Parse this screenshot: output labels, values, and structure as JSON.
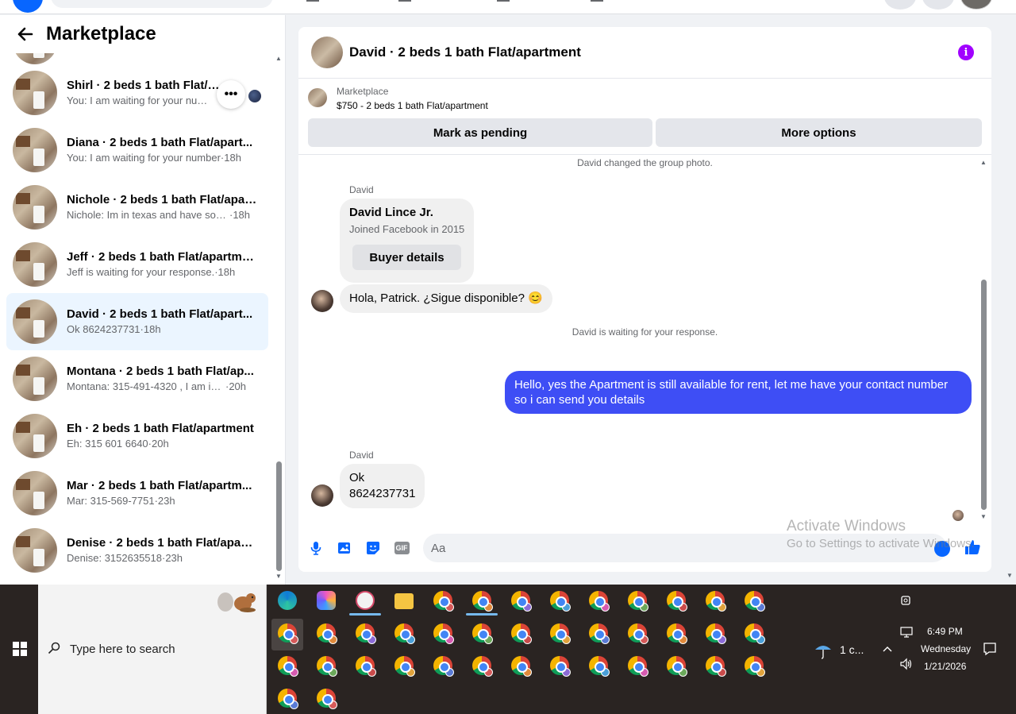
{
  "marketplace": {
    "title": "Marketplace",
    "conversations": [
      {
        "name": "Shirl · 2 beds 1 bath Flat/apartment",
        "preview": "You: I am waiting for your num...",
        "time": ""
      },
      {
        "name": "Diana · 2 beds 1 bath Flat/apart...",
        "preview": "You: I am waiting for your number",
        "time": "·18h"
      },
      {
        "name": "Nichole · 2 beds 1 bath Flat/apar...",
        "preview": "Nichole: Im in texas and have som...",
        "time": "·18h"
      },
      {
        "name": "Jeff · 2 beds 1 bath Flat/apartment",
        "preview": "Jeff is waiting for your response.",
        "time": "·18h"
      },
      {
        "name": "David · 2 beds 1 bath Flat/apart...",
        "preview": "Ok 8624237731",
        "time": "·18h"
      },
      {
        "name": "Montana · 2 beds 1 bath Flat/ap...",
        "preview": "Montana: 315-491-4320 , I am int...",
        "time": "·20h"
      },
      {
        "name": "Eh · 2 beds 1 bath Flat/apartment",
        "preview": "Eh: 315 601 6640",
        "time": "·20h"
      },
      {
        "name": "Mar · 2 beds 1 bath Flat/apartm...",
        "preview": "Mar: 315-569-7751",
        "time": "·23h"
      },
      {
        "name": "Denise · 2 beds 1 bath Flat/apart...",
        "preview": "Denise: 3152635518",
        "time": "·23h"
      }
    ],
    "more_label": "•••"
  },
  "chat": {
    "title": "David · 2 beds 1 bath Flat/apartment",
    "info_label": "i",
    "listing": {
      "label": "Marketplace",
      "price_line": "$750 - 2 beds 1 bath Flat/apartment",
      "mark_pending": "Mark as pending",
      "more_options": "More options"
    },
    "system_1": "David changed the group photo.",
    "sender_1": "David",
    "card": {
      "name": "David Lince Jr.",
      "joined": "Joined Facebook in 2015",
      "button": "Buyer details"
    },
    "msg_in_1": "Hola, Patrick. ¿Sigue disponible? 😊",
    "system_2": "David is waiting for your response.",
    "msg_out_1": "Hello, yes the Apartment is still available for rent, let me have your contact number so i can send you details",
    "sender_2": "David",
    "msg_in_2_line1": "Ok",
    "msg_in_2_line2": "8624237731",
    "composer_placeholder": "Aa",
    "gif_label": "GIF"
  },
  "watermark": {
    "line1": "Activate Windows",
    "line2": "Go to Settings to activate Windows."
  },
  "taskbar": {
    "search_placeholder": "Type here to search",
    "weather": "1 c...",
    "time": "6:49 PM",
    "day": "Wednesday",
    "date": "1/21/2026"
  },
  "colors": {
    "accent": "#0866ff",
    "outgoing_bubble": "#3e4ef5",
    "info": "#a100ff",
    "active_row": "#ebf5ff"
  }
}
